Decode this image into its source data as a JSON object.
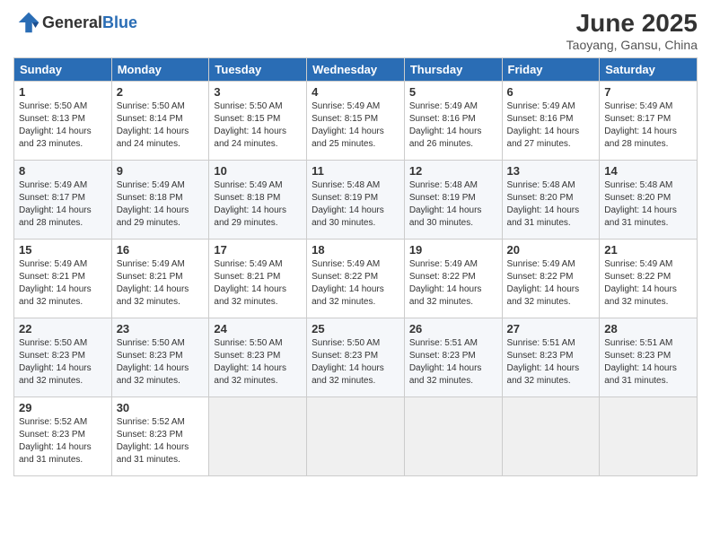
{
  "header": {
    "logo_general": "General",
    "logo_blue": "Blue",
    "month": "June 2025",
    "location": "Taoyang, Gansu, China"
  },
  "weekdays": [
    "Sunday",
    "Monday",
    "Tuesday",
    "Wednesday",
    "Thursday",
    "Friday",
    "Saturday"
  ],
  "weeks": [
    [
      {
        "day": "1",
        "sunrise": "Sunrise: 5:50 AM",
        "sunset": "Sunset: 8:13 PM",
        "daylight": "Daylight: 14 hours and 23 minutes."
      },
      {
        "day": "2",
        "sunrise": "Sunrise: 5:50 AM",
        "sunset": "Sunset: 8:14 PM",
        "daylight": "Daylight: 14 hours and 24 minutes."
      },
      {
        "day": "3",
        "sunrise": "Sunrise: 5:50 AM",
        "sunset": "Sunset: 8:15 PM",
        "daylight": "Daylight: 14 hours and 24 minutes."
      },
      {
        "day": "4",
        "sunrise": "Sunrise: 5:49 AM",
        "sunset": "Sunset: 8:15 PM",
        "daylight": "Daylight: 14 hours and 25 minutes."
      },
      {
        "day": "5",
        "sunrise": "Sunrise: 5:49 AM",
        "sunset": "Sunset: 8:16 PM",
        "daylight": "Daylight: 14 hours and 26 minutes."
      },
      {
        "day": "6",
        "sunrise": "Sunrise: 5:49 AM",
        "sunset": "Sunset: 8:16 PM",
        "daylight": "Daylight: 14 hours and 27 minutes."
      },
      {
        "day": "7",
        "sunrise": "Sunrise: 5:49 AM",
        "sunset": "Sunset: 8:17 PM",
        "daylight": "Daylight: 14 hours and 28 minutes."
      }
    ],
    [
      {
        "day": "8",
        "sunrise": "Sunrise: 5:49 AM",
        "sunset": "Sunset: 8:17 PM",
        "daylight": "Daylight: 14 hours and 28 minutes."
      },
      {
        "day": "9",
        "sunrise": "Sunrise: 5:49 AM",
        "sunset": "Sunset: 8:18 PM",
        "daylight": "Daylight: 14 hours and 29 minutes."
      },
      {
        "day": "10",
        "sunrise": "Sunrise: 5:49 AM",
        "sunset": "Sunset: 8:18 PM",
        "daylight": "Daylight: 14 hours and 29 minutes."
      },
      {
        "day": "11",
        "sunrise": "Sunrise: 5:48 AM",
        "sunset": "Sunset: 8:19 PM",
        "daylight": "Daylight: 14 hours and 30 minutes."
      },
      {
        "day": "12",
        "sunrise": "Sunrise: 5:48 AM",
        "sunset": "Sunset: 8:19 PM",
        "daylight": "Daylight: 14 hours and 30 minutes."
      },
      {
        "day": "13",
        "sunrise": "Sunrise: 5:48 AM",
        "sunset": "Sunset: 8:20 PM",
        "daylight": "Daylight: 14 hours and 31 minutes."
      },
      {
        "day": "14",
        "sunrise": "Sunrise: 5:48 AM",
        "sunset": "Sunset: 8:20 PM",
        "daylight": "Daylight: 14 hours and 31 minutes."
      }
    ],
    [
      {
        "day": "15",
        "sunrise": "Sunrise: 5:49 AM",
        "sunset": "Sunset: 8:21 PM",
        "daylight": "Daylight: 14 hours and 32 minutes."
      },
      {
        "day": "16",
        "sunrise": "Sunrise: 5:49 AM",
        "sunset": "Sunset: 8:21 PM",
        "daylight": "Daylight: 14 hours and 32 minutes."
      },
      {
        "day": "17",
        "sunrise": "Sunrise: 5:49 AM",
        "sunset": "Sunset: 8:21 PM",
        "daylight": "Daylight: 14 hours and 32 minutes."
      },
      {
        "day": "18",
        "sunrise": "Sunrise: 5:49 AM",
        "sunset": "Sunset: 8:22 PM",
        "daylight": "Daylight: 14 hours and 32 minutes."
      },
      {
        "day": "19",
        "sunrise": "Sunrise: 5:49 AM",
        "sunset": "Sunset: 8:22 PM",
        "daylight": "Daylight: 14 hours and 32 minutes."
      },
      {
        "day": "20",
        "sunrise": "Sunrise: 5:49 AM",
        "sunset": "Sunset: 8:22 PM",
        "daylight": "Daylight: 14 hours and 32 minutes."
      },
      {
        "day": "21",
        "sunrise": "Sunrise: 5:49 AM",
        "sunset": "Sunset: 8:22 PM",
        "daylight": "Daylight: 14 hours and 32 minutes."
      }
    ],
    [
      {
        "day": "22",
        "sunrise": "Sunrise: 5:50 AM",
        "sunset": "Sunset: 8:23 PM",
        "daylight": "Daylight: 14 hours and 32 minutes."
      },
      {
        "day": "23",
        "sunrise": "Sunrise: 5:50 AM",
        "sunset": "Sunset: 8:23 PM",
        "daylight": "Daylight: 14 hours and 32 minutes."
      },
      {
        "day": "24",
        "sunrise": "Sunrise: 5:50 AM",
        "sunset": "Sunset: 8:23 PM",
        "daylight": "Daylight: 14 hours and 32 minutes."
      },
      {
        "day": "25",
        "sunrise": "Sunrise: 5:50 AM",
        "sunset": "Sunset: 8:23 PM",
        "daylight": "Daylight: 14 hours and 32 minutes."
      },
      {
        "day": "26",
        "sunrise": "Sunrise: 5:51 AM",
        "sunset": "Sunset: 8:23 PM",
        "daylight": "Daylight: 14 hours and 32 minutes."
      },
      {
        "day": "27",
        "sunrise": "Sunrise: 5:51 AM",
        "sunset": "Sunset: 8:23 PM",
        "daylight": "Daylight: 14 hours and 32 minutes."
      },
      {
        "day": "28",
        "sunrise": "Sunrise: 5:51 AM",
        "sunset": "Sunset: 8:23 PM",
        "daylight": "Daylight: 14 hours and 31 minutes."
      }
    ],
    [
      {
        "day": "29",
        "sunrise": "Sunrise: 5:52 AM",
        "sunset": "Sunset: 8:23 PM",
        "daylight": "Daylight: 14 hours and 31 minutes."
      },
      {
        "day": "30",
        "sunrise": "Sunrise: 5:52 AM",
        "sunset": "Sunset: 8:23 PM",
        "daylight": "Daylight: 14 hours and 31 minutes."
      },
      null,
      null,
      null,
      null,
      null
    ]
  ]
}
